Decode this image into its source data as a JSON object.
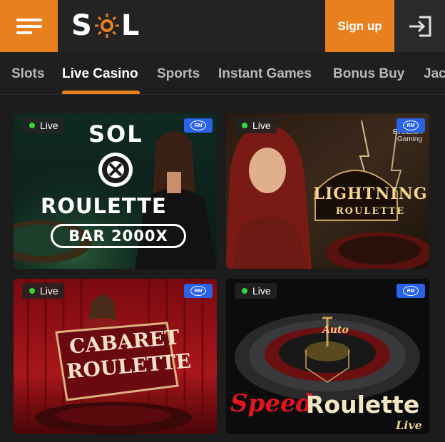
{
  "header": {
    "logo_text_left": "S",
    "logo_text_right": "L",
    "signup_label": "Sign up"
  },
  "tabs": [
    {
      "label": "Slots",
      "active": false
    },
    {
      "label": "Live Casino",
      "active": true
    },
    {
      "label": "Sports",
      "active": false
    },
    {
      "label": "Instant Games",
      "active": false
    },
    {
      "label": "Bonus Buy",
      "active": false
    },
    {
      "label": "Jac",
      "active": false
    }
  ],
  "games": [
    {
      "status": "Live",
      "badge": "RM",
      "logo": "SOL",
      "title": "ROULETTE",
      "subtitle": "BAR 2000X"
    },
    {
      "status": "Live",
      "badge": "RM",
      "provider": "Evolution Gaming",
      "title": "LIGHTNING",
      "subtitle": "ROULETTE"
    },
    {
      "status": "Live",
      "badge": "RM",
      "title": "CABARET",
      "subtitle": "ROULETTE"
    },
    {
      "status": "Live",
      "badge": "RM",
      "title_a": "Speed",
      "title_b": "Roulette",
      "subtitle": "Live",
      "wheel_label": "Auto"
    }
  ],
  "colors": {
    "accent": "#e8801f",
    "live_dot": "#35d637",
    "rm_badge": "#2a62e6"
  }
}
